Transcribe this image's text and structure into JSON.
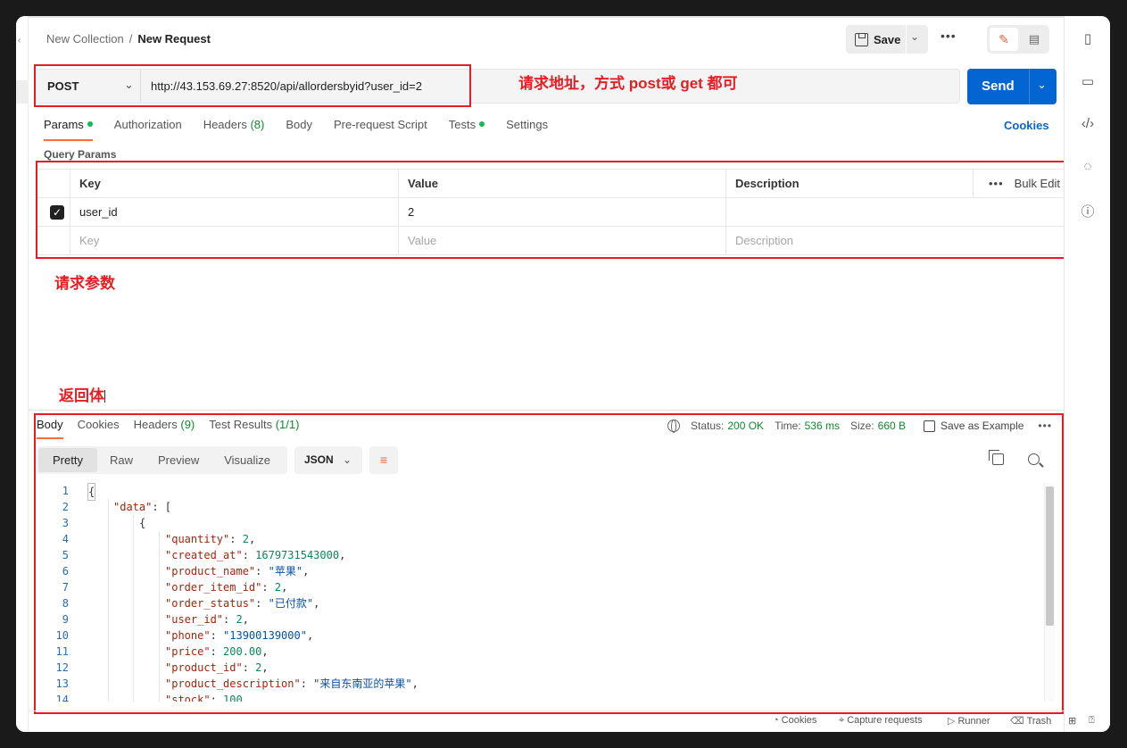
{
  "breadcrumb": {
    "collection": "New Collection",
    "separator": "/",
    "request": "New Request"
  },
  "toolbar": {
    "save_label": "Save",
    "more_label": "•••",
    "edit_mode_icon": "pencil-icon",
    "comment_mode_icon": "comment-icon"
  },
  "request": {
    "method": "POST",
    "url": "http://43.153.69.27:8520/api/allordersbyid?user_id=2",
    "send_label": "Send"
  },
  "annotations": {
    "url_note": "请求地址，方式 post或 get 都可",
    "params_note": "请求参数",
    "body_note": "返回体"
  },
  "request_tabs": {
    "params": "Params",
    "authorization": "Authorization",
    "headers": "Headers",
    "headers_count": "(8)",
    "body": "Body",
    "prerequest": "Pre-request Script",
    "tests": "Tests",
    "settings": "Settings",
    "cookies": "Cookies"
  },
  "query_params": {
    "title": "Query Params",
    "columns": {
      "key": "Key",
      "value": "Value",
      "description": "Description"
    },
    "bulk_edit": "Bulk Edit",
    "more": "•••",
    "rows": [
      {
        "checked": true,
        "key": "user_id",
        "value": "2",
        "description": ""
      }
    ],
    "placeholders": {
      "key": "Key",
      "value": "Value",
      "description": "Description"
    }
  },
  "response": {
    "tabs": {
      "body": "Body",
      "cookies": "Cookies",
      "headers": "Headers",
      "headers_count": "(9)",
      "test_results": "Test Results",
      "test_results_count": "(1/1)"
    },
    "status_label": "Status:",
    "status": "200 OK",
    "time_label": "Time:",
    "time": "536 ms",
    "size_label": "Size:",
    "size": "660 B",
    "save_example": "Save as Example",
    "more": "•••",
    "views": {
      "pretty": "Pretty",
      "raw": "Raw",
      "preview": "Preview",
      "visualize": "Visualize"
    },
    "format": "JSON",
    "line_numbers": [
      "1",
      "2",
      "3",
      "4",
      "5",
      "6",
      "7",
      "8",
      "9",
      "10",
      "11",
      "12",
      "13",
      "14"
    ],
    "json": {
      "open": "{",
      "data_key": "\"data\"",
      "open_obj": "{",
      "fields": [
        {
          "key": "\"quantity\"",
          "value": "2",
          "type": "num"
        },
        {
          "key": "\"created_at\"",
          "value": "1679731543000",
          "type": "num"
        },
        {
          "key": "\"product_name\"",
          "value": "\"苹果\"",
          "type": "str"
        },
        {
          "key": "\"order_item_id\"",
          "value": "2",
          "type": "num"
        },
        {
          "key": "\"order_status\"",
          "value": "\"已付款\"",
          "type": "str"
        },
        {
          "key": "\"user_id\"",
          "value": "2",
          "type": "num"
        },
        {
          "key": "\"phone\"",
          "value": "\"13900139000\"",
          "type": "str"
        },
        {
          "key": "\"price\"",
          "value": "200.00",
          "type": "num"
        },
        {
          "key": "\"product_id\"",
          "value": "2",
          "type": "num"
        },
        {
          "key": "\"product_description\"",
          "value": "\"来自东南亚的苹果\"",
          "type": "str"
        },
        {
          "key": "\"stock\"",
          "value": "100",
          "type": "num"
        }
      ]
    }
  },
  "footer": {
    "cookies": "Cookies",
    "capture": "Capture requests",
    "runner": "Runner",
    "trash": "Trash"
  },
  "colors": {
    "accent": "#ff6c37",
    "send": "#0265d2",
    "annotation": "#e31e24",
    "status_ok": "#0f8a2f"
  }
}
